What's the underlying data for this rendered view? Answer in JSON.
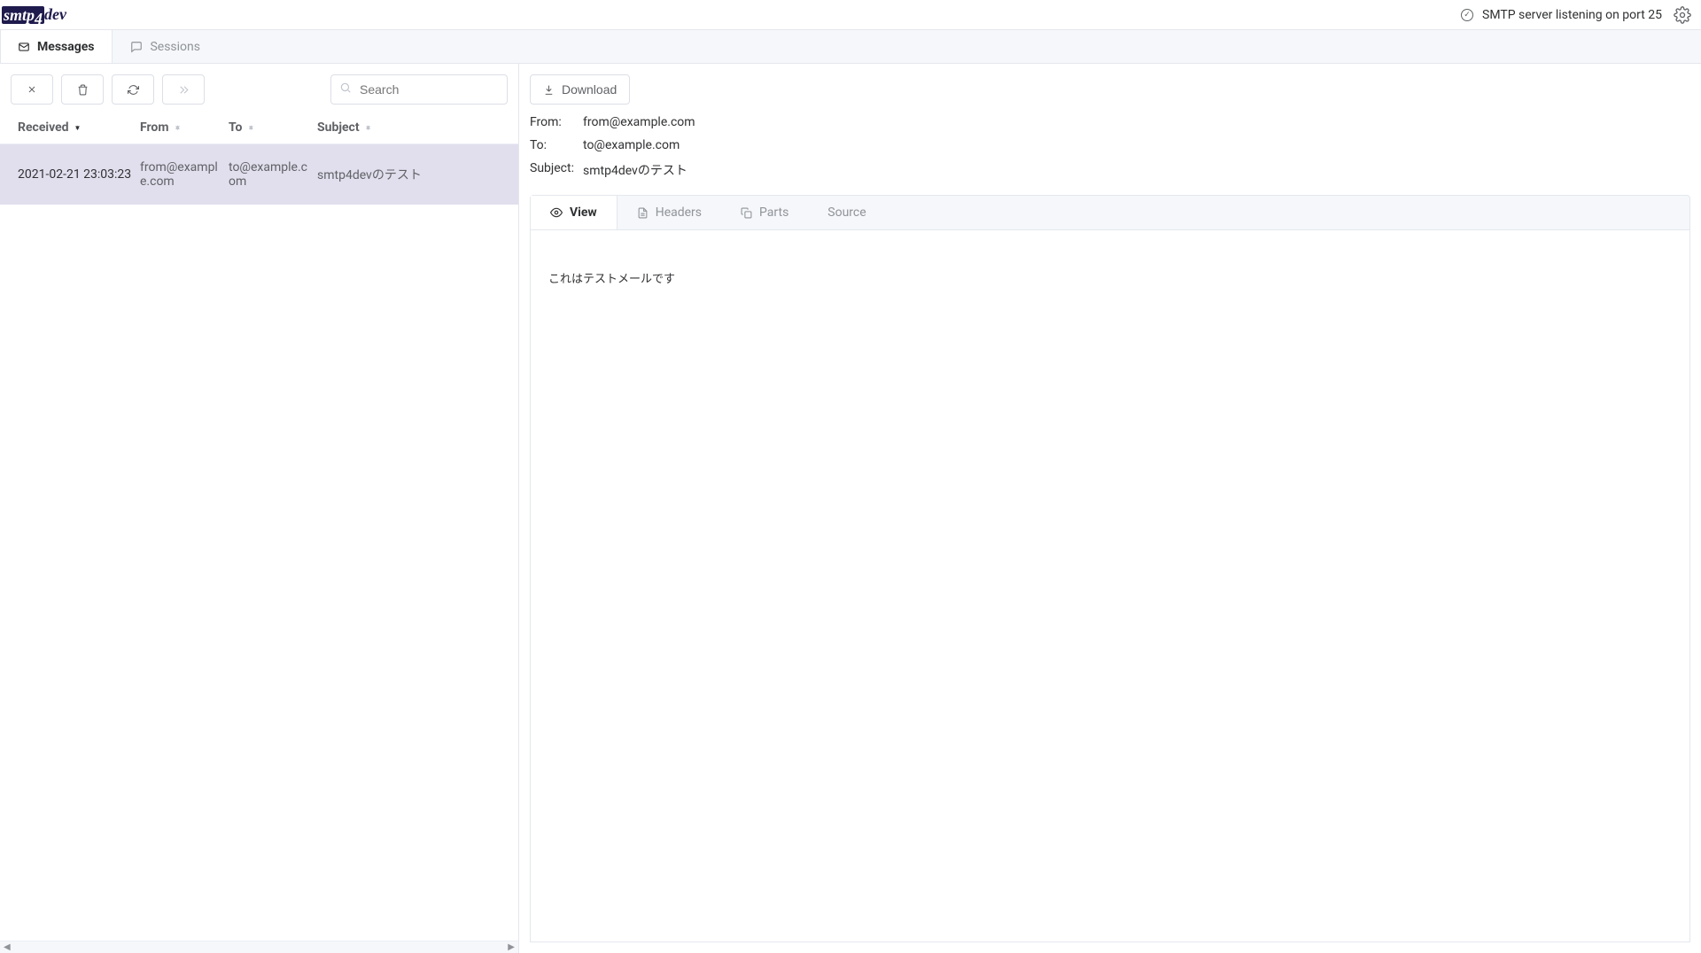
{
  "header": {
    "logo_a": "smtp",
    "logo_b": "4",
    "logo_c": "dev",
    "status_text": "SMTP server listening on port 25"
  },
  "top_tabs": {
    "messages": "Messages",
    "sessions": "Sessions"
  },
  "toolbar": {
    "search_placeholder": "Search",
    "download_label": "Download"
  },
  "columns": {
    "received": "Received",
    "from": "From",
    "to": "To",
    "subject": "Subject"
  },
  "rows": [
    {
      "received": "2021-02-21 23:03:23",
      "from": "from@example.com",
      "to": "to@example.com",
      "subject": "smtp4devのテスト"
    }
  ],
  "detail": {
    "labels": {
      "from": "From:",
      "to": "To:",
      "subject": "Subject:"
    },
    "from": "from@example.com",
    "to": "to@example.com",
    "subject": "smtp4devのテスト",
    "tabs": {
      "view": "View",
      "headers": "Headers",
      "parts": "Parts",
      "source": "Source"
    },
    "body": "これはテストメールです"
  }
}
